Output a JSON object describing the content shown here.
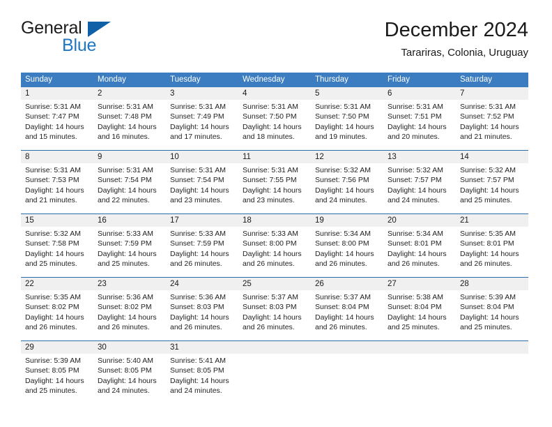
{
  "brand": {
    "word_one": "General",
    "word_two": "Blue",
    "flag_icon": "blue-triangle-flag-icon",
    "primary_color": "#1060a8",
    "accent_color": "#2077c4"
  },
  "header": {
    "title": "December 2024",
    "subtitle": "Tarariras, Colonia, Uruguay"
  },
  "calendar": {
    "header_bg": "#3b7dc0",
    "daynum_bg": "#f0f0f0",
    "separator_color": "#2b6cad",
    "weekdays": [
      "Sunday",
      "Monday",
      "Tuesday",
      "Wednesday",
      "Thursday",
      "Friday",
      "Saturday"
    ],
    "weeks": [
      [
        {
          "day": "1",
          "sunrise": "Sunrise: 5:31 AM",
          "sunset": "Sunset: 7:47 PM",
          "daylight_1": "Daylight: 14 hours",
          "daylight_2": "and 15 minutes."
        },
        {
          "day": "2",
          "sunrise": "Sunrise: 5:31 AM",
          "sunset": "Sunset: 7:48 PM",
          "daylight_1": "Daylight: 14 hours",
          "daylight_2": "and 16 minutes."
        },
        {
          "day": "3",
          "sunrise": "Sunrise: 5:31 AM",
          "sunset": "Sunset: 7:49 PM",
          "daylight_1": "Daylight: 14 hours",
          "daylight_2": "and 17 minutes."
        },
        {
          "day": "4",
          "sunrise": "Sunrise: 5:31 AM",
          "sunset": "Sunset: 7:50 PM",
          "daylight_1": "Daylight: 14 hours",
          "daylight_2": "and 18 minutes."
        },
        {
          "day": "5",
          "sunrise": "Sunrise: 5:31 AM",
          "sunset": "Sunset: 7:50 PM",
          "daylight_1": "Daylight: 14 hours",
          "daylight_2": "and 19 minutes."
        },
        {
          "day": "6",
          "sunrise": "Sunrise: 5:31 AM",
          "sunset": "Sunset: 7:51 PM",
          "daylight_1": "Daylight: 14 hours",
          "daylight_2": "and 20 minutes."
        },
        {
          "day": "7",
          "sunrise": "Sunrise: 5:31 AM",
          "sunset": "Sunset: 7:52 PM",
          "daylight_1": "Daylight: 14 hours",
          "daylight_2": "and 21 minutes."
        }
      ],
      [
        {
          "day": "8",
          "sunrise": "Sunrise: 5:31 AM",
          "sunset": "Sunset: 7:53 PM",
          "daylight_1": "Daylight: 14 hours",
          "daylight_2": "and 21 minutes."
        },
        {
          "day": "9",
          "sunrise": "Sunrise: 5:31 AM",
          "sunset": "Sunset: 7:54 PM",
          "daylight_1": "Daylight: 14 hours",
          "daylight_2": "and 22 minutes."
        },
        {
          "day": "10",
          "sunrise": "Sunrise: 5:31 AM",
          "sunset": "Sunset: 7:54 PM",
          "daylight_1": "Daylight: 14 hours",
          "daylight_2": "and 23 minutes."
        },
        {
          "day": "11",
          "sunrise": "Sunrise: 5:31 AM",
          "sunset": "Sunset: 7:55 PM",
          "daylight_1": "Daylight: 14 hours",
          "daylight_2": "and 23 minutes."
        },
        {
          "day": "12",
          "sunrise": "Sunrise: 5:32 AM",
          "sunset": "Sunset: 7:56 PM",
          "daylight_1": "Daylight: 14 hours",
          "daylight_2": "and 24 minutes."
        },
        {
          "day": "13",
          "sunrise": "Sunrise: 5:32 AM",
          "sunset": "Sunset: 7:57 PM",
          "daylight_1": "Daylight: 14 hours",
          "daylight_2": "and 24 minutes."
        },
        {
          "day": "14",
          "sunrise": "Sunrise: 5:32 AM",
          "sunset": "Sunset: 7:57 PM",
          "daylight_1": "Daylight: 14 hours",
          "daylight_2": "and 25 minutes."
        }
      ],
      [
        {
          "day": "15",
          "sunrise": "Sunrise: 5:32 AM",
          "sunset": "Sunset: 7:58 PM",
          "daylight_1": "Daylight: 14 hours",
          "daylight_2": "and 25 minutes."
        },
        {
          "day": "16",
          "sunrise": "Sunrise: 5:33 AM",
          "sunset": "Sunset: 7:59 PM",
          "daylight_1": "Daylight: 14 hours",
          "daylight_2": "and 25 minutes."
        },
        {
          "day": "17",
          "sunrise": "Sunrise: 5:33 AM",
          "sunset": "Sunset: 7:59 PM",
          "daylight_1": "Daylight: 14 hours",
          "daylight_2": "and 26 minutes."
        },
        {
          "day": "18",
          "sunrise": "Sunrise: 5:33 AM",
          "sunset": "Sunset: 8:00 PM",
          "daylight_1": "Daylight: 14 hours",
          "daylight_2": "and 26 minutes."
        },
        {
          "day": "19",
          "sunrise": "Sunrise: 5:34 AM",
          "sunset": "Sunset: 8:00 PM",
          "daylight_1": "Daylight: 14 hours",
          "daylight_2": "and 26 minutes."
        },
        {
          "day": "20",
          "sunrise": "Sunrise: 5:34 AM",
          "sunset": "Sunset: 8:01 PM",
          "daylight_1": "Daylight: 14 hours",
          "daylight_2": "and 26 minutes."
        },
        {
          "day": "21",
          "sunrise": "Sunrise: 5:35 AM",
          "sunset": "Sunset: 8:01 PM",
          "daylight_1": "Daylight: 14 hours",
          "daylight_2": "and 26 minutes."
        }
      ],
      [
        {
          "day": "22",
          "sunrise": "Sunrise: 5:35 AM",
          "sunset": "Sunset: 8:02 PM",
          "daylight_1": "Daylight: 14 hours",
          "daylight_2": "and 26 minutes."
        },
        {
          "day": "23",
          "sunrise": "Sunrise: 5:36 AM",
          "sunset": "Sunset: 8:02 PM",
          "daylight_1": "Daylight: 14 hours",
          "daylight_2": "and 26 minutes."
        },
        {
          "day": "24",
          "sunrise": "Sunrise: 5:36 AM",
          "sunset": "Sunset: 8:03 PM",
          "daylight_1": "Daylight: 14 hours",
          "daylight_2": "and 26 minutes."
        },
        {
          "day": "25",
          "sunrise": "Sunrise: 5:37 AM",
          "sunset": "Sunset: 8:03 PM",
          "daylight_1": "Daylight: 14 hours",
          "daylight_2": "and 26 minutes."
        },
        {
          "day": "26",
          "sunrise": "Sunrise: 5:37 AM",
          "sunset": "Sunset: 8:04 PM",
          "daylight_1": "Daylight: 14 hours",
          "daylight_2": "and 26 minutes."
        },
        {
          "day": "27",
          "sunrise": "Sunrise: 5:38 AM",
          "sunset": "Sunset: 8:04 PM",
          "daylight_1": "Daylight: 14 hours",
          "daylight_2": "and 25 minutes."
        },
        {
          "day": "28",
          "sunrise": "Sunrise: 5:39 AM",
          "sunset": "Sunset: 8:04 PM",
          "daylight_1": "Daylight: 14 hours",
          "daylight_2": "and 25 minutes."
        }
      ],
      [
        {
          "day": "29",
          "sunrise": "Sunrise: 5:39 AM",
          "sunset": "Sunset: 8:05 PM",
          "daylight_1": "Daylight: 14 hours",
          "daylight_2": "and 25 minutes."
        },
        {
          "day": "30",
          "sunrise": "Sunrise: 5:40 AM",
          "sunset": "Sunset: 8:05 PM",
          "daylight_1": "Daylight: 14 hours",
          "daylight_2": "and 24 minutes."
        },
        {
          "day": "31",
          "sunrise": "Sunrise: 5:41 AM",
          "sunset": "Sunset: 8:05 PM",
          "daylight_1": "Daylight: 14 hours",
          "daylight_2": "and 24 minutes."
        },
        {
          "day": "",
          "sunrise": "",
          "sunset": "",
          "daylight_1": "",
          "daylight_2": ""
        },
        {
          "day": "",
          "sunrise": "",
          "sunset": "",
          "daylight_1": "",
          "daylight_2": ""
        },
        {
          "day": "",
          "sunrise": "",
          "sunset": "",
          "daylight_1": "",
          "daylight_2": ""
        },
        {
          "day": "",
          "sunrise": "",
          "sunset": "",
          "daylight_1": "",
          "daylight_2": ""
        }
      ]
    ]
  }
}
